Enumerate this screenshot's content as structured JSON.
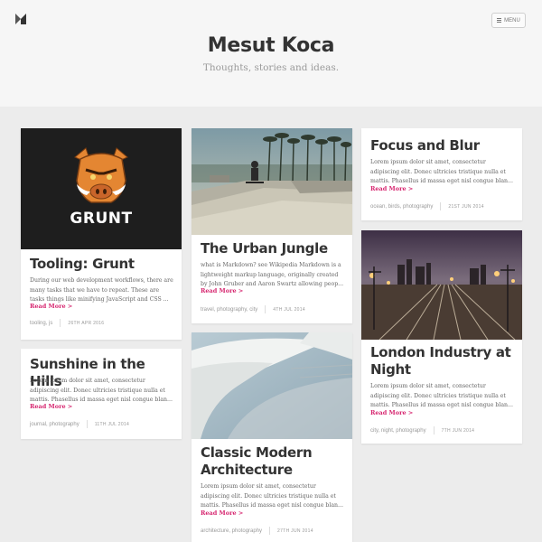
{
  "site": {
    "title": "Mesut Koca",
    "tagline": "Thoughts, stories and ideas.",
    "menu_label": "MENU"
  },
  "posts": [
    {
      "title": "Tooling: Grunt",
      "image_text": "GRUNT",
      "excerpt": "During our web development workflows, there are many tasks that we have to repeat. These are tasks things like minifying JavaScript and CSS ...",
      "read_more": "Read More",
      "tags": "tooling, js",
      "date": "26TH APR 2016"
    },
    {
      "title": "Sunshine in the Hills",
      "excerpt": "Lorem ipsum dolor sit amet, consectetur adipiscing elit. Donec ultricies tristique nulla et mattis. Phasellus id massa eget nisl congue blan...",
      "read_more": "Read More",
      "tags": "journal, photography",
      "date": "11TH JUL 2014"
    },
    {
      "title": "The Urban Jungle",
      "excerpt": "what is Markdown? see Wikipedia Markdown is a lightweight markup language, originally created by John Gruber and Aaron Swartz allowing peop...",
      "read_more": "Read More",
      "tags": "travel, photography, city",
      "date": "4TH JUL 2014"
    },
    {
      "title": "Classic Modern Architecture",
      "excerpt": "Lorem ipsum dolor sit amet, consectetur adipiscing elit. Donec ultricies tristique nulla et mattis. Phasellus id massa eget nisl congue blan...",
      "read_more": "Read More",
      "tags": "architecture, photography",
      "date": "27TH JUN 2014"
    },
    {
      "title": "Focus and Blur",
      "excerpt": "Lorem ipsum dolor sit amet, consectetur adipiscing elit. Donec ultricies tristique nulla et mattis. Phasellus id massa eget nisl congue blan...",
      "read_more": "Read More",
      "tags": "ocean, birds, photography",
      "date": "21ST JUN 2014"
    },
    {
      "title": "London Industry at Night",
      "excerpt": "Lorem ipsum dolor sit amet, consectetur adipiscing elit. Donec ultricies tristique nulla et mattis. Phasellus id massa eget nisl congue blan...",
      "read_more": "Read More",
      "tags": "city, night, photography",
      "date": "7TH JUN 2014"
    }
  ],
  "colors": {
    "accent": "#d6246e",
    "grunt_orange": "#e48632",
    "page_background": "#ececec"
  }
}
